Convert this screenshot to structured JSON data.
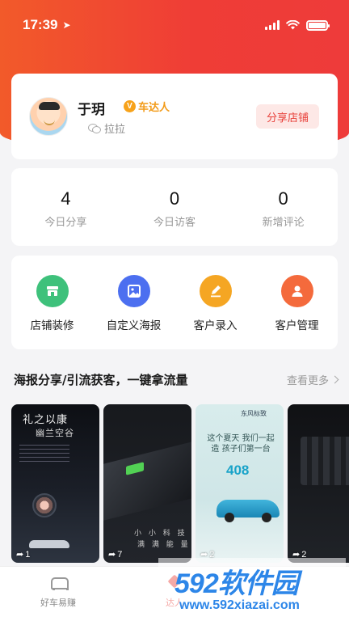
{
  "status_bar": {
    "time": "17:39"
  },
  "profile": {
    "name": "于玥",
    "badge_letter": "V",
    "badge_text": "车达人",
    "wechat_name": "拉拉",
    "share_button": "分享店铺"
  },
  "stats": [
    {
      "value": "4",
      "label": "今日分享"
    },
    {
      "value": "0",
      "label": "今日访客"
    },
    {
      "value": "0",
      "label": "新增评论"
    }
  ],
  "tools": [
    {
      "label": "店铺装修",
      "icon": "shop-icon",
      "color": "#3ec17b"
    },
    {
      "label": "自定义海报",
      "icon": "image-icon",
      "color": "#4c6ff0"
    },
    {
      "label": "客户录入",
      "icon": "edit-icon",
      "color": "#f5a623"
    },
    {
      "label": "客户管理",
      "icon": "user-icon",
      "color": "#f46a3c"
    }
  ],
  "poster_section": {
    "title": "海报分享/引流获客，一键拿流量",
    "see_more": "查看更多"
  },
  "posters": [
    {
      "title": "礼之以康",
      "subtitle": "幽兰空谷",
      "shares": "1"
    },
    {
      "line1": "小 小 科 技",
      "line2": "满 满 能 量",
      "shares": "7"
    },
    {
      "brand": "东风标致",
      "headline": "这个夏天 我们一起造 孩子们第一台",
      "model": "408",
      "shares": "2"
    },
    {
      "shares": "2"
    }
  ],
  "tabbar": [
    {
      "label": "好车易赚",
      "active": false
    },
    {
      "label": "达人",
      "active": true
    }
  ],
  "watermark": {
    "brand": "592软件园",
    "url": "www.592xiazai.com"
  },
  "colors": {
    "brand_red": "#e8413b",
    "header_gradient_start": "#f25a2a",
    "header_gradient_end": "#ee3b3a",
    "badge_orange": "#f29a17"
  }
}
